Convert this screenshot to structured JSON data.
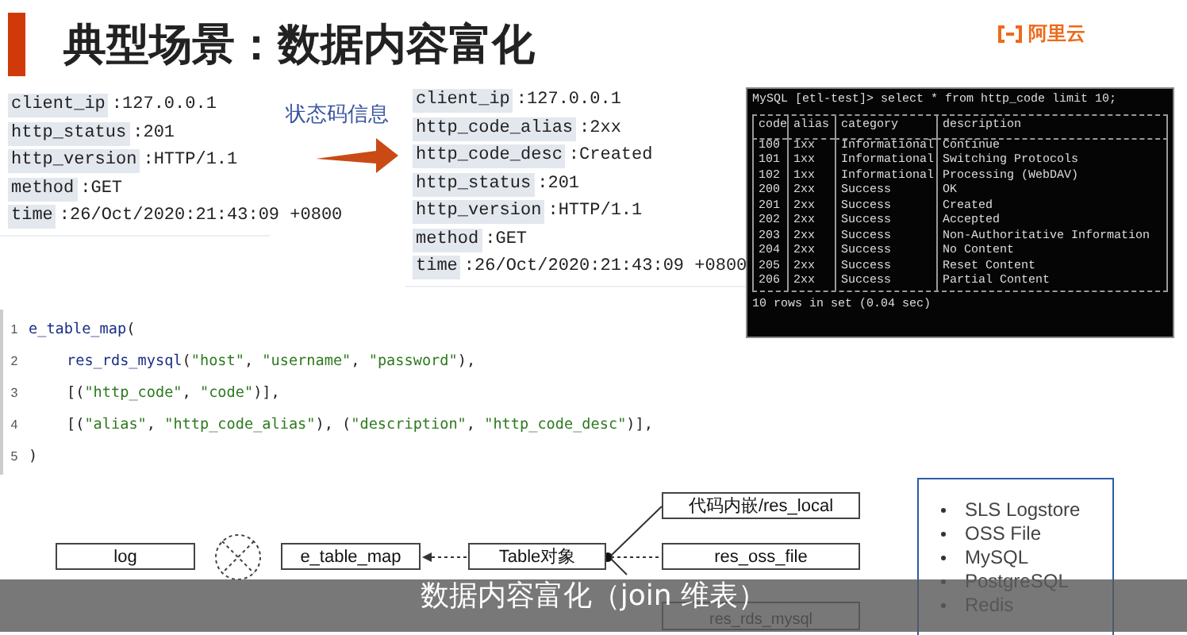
{
  "title": "典型场景：数据内容富化",
  "logo": {
    "text": "阿里云"
  },
  "separator": ":",
  "source_record": [
    {
      "key": "client_ip",
      "value": "127.0.0.1"
    },
    {
      "key": "http_status",
      "value": "201"
    },
    {
      "key": "http_version",
      "value": "HTTP/1.1"
    },
    {
      "key": "method",
      "value": "GET"
    },
    {
      "key": "time",
      "value": "26/Oct/2020:21:43:09 +0800"
    }
  ],
  "arrow_label": "状态码信息",
  "enriched_record": [
    {
      "key": "client_ip",
      "value": "127.0.0.1"
    },
    {
      "key": "http_code_alias",
      "value": "2xx"
    },
    {
      "key": "http_code_desc",
      "value": "Created"
    },
    {
      "key": "http_status",
      "value": "201"
    },
    {
      "key": "http_version",
      "value": "HTTP/1.1"
    },
    {
      "key": "method",
      "value": "GET"
    },
    {
      "key": "time",
      "value": "26/Oct/2020:21:43:09 +0800"
    }
  ],
  "terminal": {
    "command": "MySQL [etl-test]> select * from http_code limit 10;",
    "columns": [
      "code",
      "alias",
      "category",
      "description"
    ],
    "rows": [
      [
        "100",
        "1xx",
        "Informational",
        "Continue"
      ],
      [
        "101",
        "1xx",
        "Informational",
        "Switching Protocols"
      ],
      [
        "102",
        "1xx",
        "Informational",
        "Processing (WebDAV)"
      ],
      [
        "200",
        "2xx",
        "Success",
        "OK"
      ],
      [
        "201",
        "2xx",
        "Success",
        "Created"
      ],
      [
        "202",
        "2xx",
        "Success",
        "Accepted"
      ],
      [
        "203",
        "2xx",
        "Success",
        "Non-Authoritative Information"
      ],
      [
        "204",
        "2xx",
        "Success",
        "No Content"
      ],
      [
        "205",
        "2xx",
        "Success",
        "Reset Content"
      ],
      [
        "206",
        "2xx",
        "Success",
        "Partial Content"
      ]
    ],
    "footer": "10 rows in set (0.04 sec)"
  },
  "code": [
    {
      "number": "1",
      "indented": false,
      "tokens": [
        {
          "kind": "func",
          "text": "e_table_map"
        },
        {
          "kind": "punct",
          "text": "("
        }
      ]
    },
    {
      "number": "2",
      "indented": true,
      "tokens": [
        {
          "kind": "func",
          "text": "res_rds_mysql"
        },
        {
          "kind": "punct",
          "text": "("
        },
        {
          "kind": "string",
          "text": "\"host\""
        },
        {
          "kind": "punct",
          "text": ", "
        },
        {
          "kind": "string",
          "text": "\"username\""
        },
        {
          "kind": "punct",
          "text": ", "
        },
        {
          "kind": "string",
          "text": "\"password\""
        },
        {
          "kind": "punct",
          "text": "),"
        }
      ]
    },
    {
      "number": "3",
      "indented": true,
      "tokens": [
        {
          "kind": "punct",
          "text": "[("
        },
        {
          "kind": "string",
          "text": "\"http_code\""
        },
        {
          "kind": "punct",
          "text": ", "
        },
        {
          "kind": "string",
          "text": "\"code\""
        },
        {
          "kind": "punct",
          "text": ")],"
        }
      ]
    },
    {
      "number": "4",
      "indented": true,
      "tokens": [
        {
          "kind": "punct",
          "text": "[("
        },
        {
          "kind": "string",
          "text": "\"alias\""
        },
        {
          "kind": "punct",
          "text": ", "
        },
        {
          "kind": "string",
          "text": "\"http_code_alias\""
        },
        {
          "kind": "punct",
          "text": "), ("
        },
        {
          "kind": "string",
          "text": "\"description\""
        },
        {
          "kind": "punct",
          "text": ", "
        },
        {
          "kind": "string",
          "text": "\"http_code_desc\""
        },
        {
          "kind": "punct",
          "text": ")],"
        }
      ]
    },
    {
      "number": "5",
      "indented": false,
      "tokens": [
        {
          "kind": "punct",
          "text": ")"
        }
      ]
    }
  ],
  "diagram": {
    "nodes": [
      "log",
      "e_table_map",
      "Table对象",
      "代码内嵌/res_local",
      "res_oss_file",
      "res_rds_mysql"
    ],
    "sources": [
      "SLS Logstore",
      "OSS File",
      "MySQL",
      "PostgreSQL",
      "Redis"
    ]
  },
  "subtitle": "数据内容富化（join 维表）"
}
